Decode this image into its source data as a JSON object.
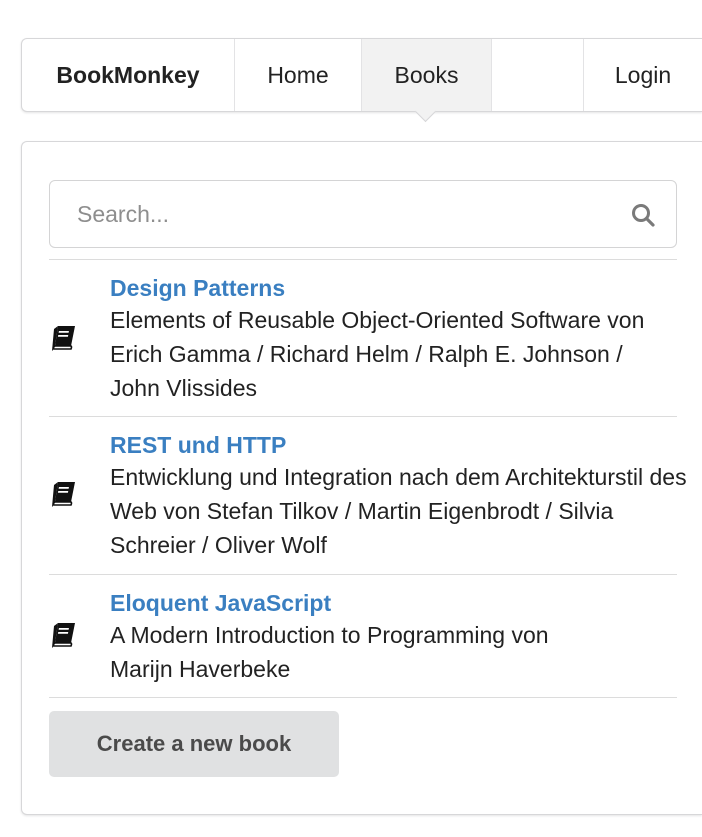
{
  "menu": {
    "brand": "BookMonkey",
    "home": "Home",
    "books": "Books",
    "login": "Login"
  },
  "search": {
    "placeholder": "Search...",
    "value": ""
  },
  "books": [
    {
      "title": "Design Patterns",
      "subtitle": "Elements of Reusable Object-Oriented Software",
      "authors_line": "von Erich Gamma / Richard Helm / Ralph E. Johnson / John Vlissides",
      "icon": "book-icon"
    },
    {
      "title": "REST und HTTP",
      "subtitle": "Entwicklung und Integration nach dem Architekturstil des Web",
      "authors_line": "von Stefan Tilkov / Martin Eigenbrodt / Silvia Schreier / Oliver Wolf",
      "icon": "book-icon"
    },
    {
      "title": "Eloquent JavaScript",
      "subtitle": "A Modern Introduction to Programming",
      "authors_line": "von Marijn Haverbeke",
      "icon": "book-icon"
    }
  ],
  "actions": {
    "create_label": "Create a new book"
  },
  "colors": {
    "link": "#3a7fc1",
    "active_menu_bg": "#f2f2f2",
    "button_bg": "#e0e1e2"
  }
}
